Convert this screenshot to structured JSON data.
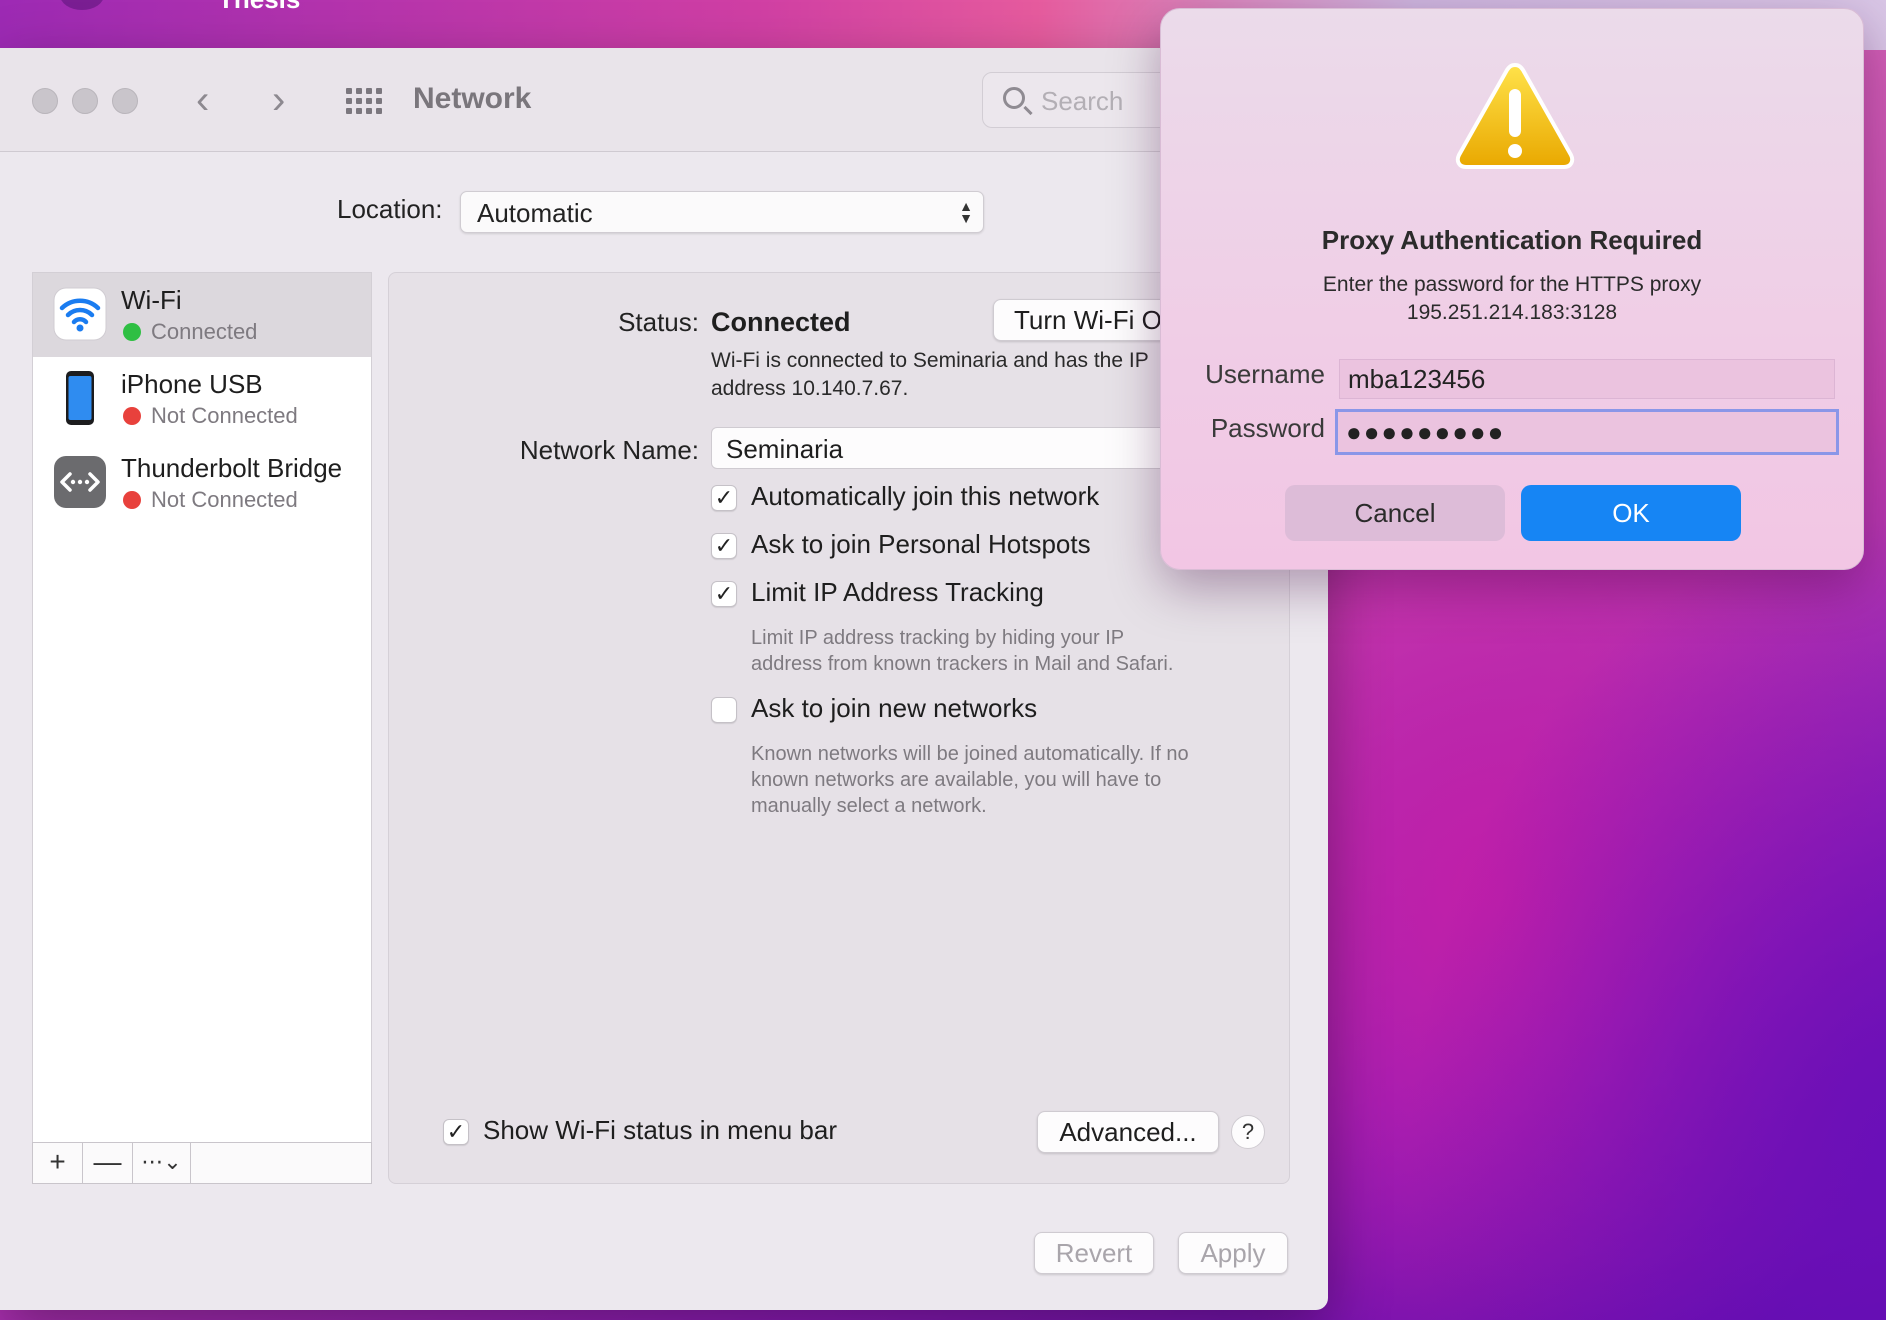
{
  "wallpaper": {
    "app_title": "Thesis"
  },
  "window": {
    "title": "Network",
    "search_placeholder": "Search",
    "nav": {
      "back": "‹",
      "forward": "›"
    }
  },
  "location": {
    "label": "Location:",
    "value": "Automatic"
  },
  "services": [
    {
      "name": "Wi-Fi",
      "status": "Connected",
      "status_color": "#2fbf43",
      "selected": true
    },
    {
      "name": "iPhone USB",
      "status": "Not Connected",
      "status_color": "#e8413c",
      "selected": false
    },
    {
      "name": "Thunderbolt Bridge",
      "status": "Not Connected",
      "status_color": "#e8413c",
      "selected": false
    }
  ],
  "sidebar_tools": {
    "add": "+",
    "remove": "—",
    "more": "⋯⌄"
  },
  "detail": {
    "status_label": "Status:",
    "status_value": "Connected",
    "turn_off_button": "Turn Wi-Fi Off",
    "status_desc_line1": "Wi-Fi is connected to Seminaria and has the IP",
    "status_desc_line2": "address 10.140.7.67.",
    "network_name_label": "Network Name:",
    "network_name_value": "Seminaria",
    "options": [
      {
        "label": "Automatically join this network",
        "checked": true
      },
      {
        "label": "Ask to join Personal Hotspots",
        "checked": true
      },
      {
        "label": "Limit IP Address Tracking",
        "checked": true
      },
      {
        "label": "Ask to join new networks",
        "checked": false
      }
    ],
    "limit_hint_line1": "Limit IP address tracking by hiding your IP",
    "limit_hint_line2": "address from known trackers in Mail and Safari.",
    "new_net_hint_line1": "Known networks will be joined automatically. If no",
    "new_net_hint_line2": "known networks are available, you will have to",
    "new_net_hint_line3": "manually select a network.",
    "show_status_label": "Show Wi-Fi status in menu bar",
    "show_status_checked": true,
    "advanced_button": "Advanced...",
    "help_button": "?"
  },
  "footer": {
    "revert": "Revert",
    "apply": "Apply"
  },
  "dialog": {
    "title": "Proxy Authentication Required",
    "message_line1": "Enter the password for the HTTPS proxy",
    "message_line2": "195.251.214.183:3128",
    "username_label": "Username",
    "username_value": "mba123456",
    "password_label": "Password",
    "password_value": "●●●●●●●●●",
    "cancel": "Cancel",
    "ok": "OK",
    "accent_color": "#1685f4"
  }
}
